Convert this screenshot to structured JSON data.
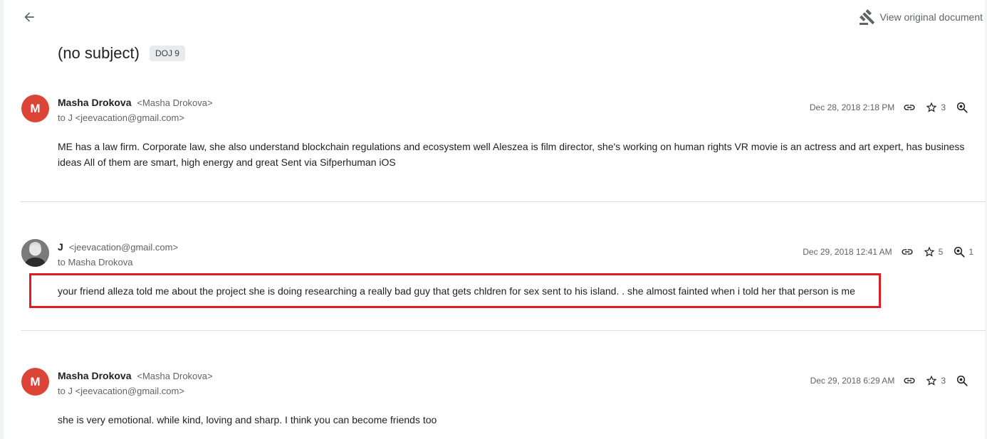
{
  "header": {
    "back_icon": "arrow-left-icon",
    "view_original_label": "View original document",
    "view_original_icon": "gavel-icon"
  },
  "subject": {
    "title": "(no subject)",
    "tag": "DOJ 9"
  },
  "messages": [
    {
      "avatar_letter": "M",
      "avatar_color": "#db4437",
      "sender_name": "Masha Drokova",
      "sender_email": "<Masha Drokova>",
      "to_line": "to J <jeevacation@gmail.com>",
      "date": "Dec 28, 2018 2:18 PM",
      "star_count": "3",
      "zoom_count": "",
      "body": "ME has a law firm. Corporate law, she also understand blockchain regulations and ecosystem well Aleszea is film director, she's working on human rights VR movie is an actress and art expert, has business ideas All of them are smart, high energy and great Sent via Sifperhuman iOS"
    },
    {
      "avatar_letter": "",
      "avatar_color": "#6b6b6b",
      "sender_name": "J",
      "sender_email": "<jeevacation@gmail.com>",
      "to_line": "to Masha Drokova",
      "date": "Dec 29, 2018 12:41 AM",
      "star_count": "5",
      "zoom_count": "1",
      "body": "your friend alleza told me about the project she is doing researching a really bad guy that gets chldren for sex sent to his island. . she almost fainted when i told her that person is me"
    },
    {
      "avatar_letter": "M",
      "avatar_color": "#db4437",
      "sender_name": "Masha Drokova",
      "sender_email": "<Masha Drokova>",
      "to_line": "to J <jeevacation@gmail.com>",
      "date": "Dec 29, 2018 6:29 AM",
      "star_count": "3",
      "zoom_count": "",
      "body": "she is very emotional. while kind, loving and sharp. I think you can become friends too"
    }
  ],
  "highlight_color": "#e21c23"
}
